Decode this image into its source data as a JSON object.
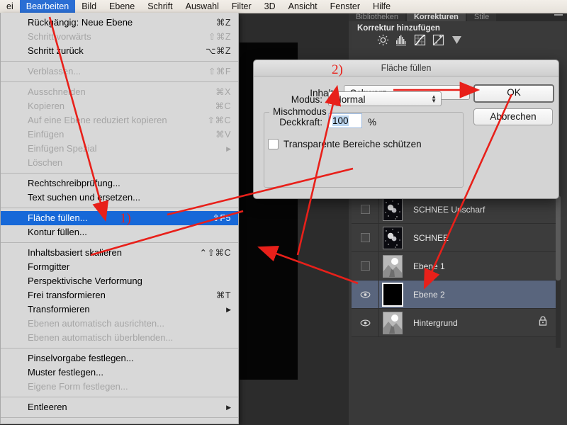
{
  "menubar": {
    "items": [
      {
        "label": "ei",
        "active": false,
        "truncated": true
      },
      {
        "label": "Bearbeiten",
        "active": true
      },
      {
        "label": "Bild",
        "active": false
      },
      {
        "label": "Ebene",
        "active": false
      },
      {
        "label": "Schrift",
        "active": false
      },
      {
        "label": "Auswahl",
        "active": false
      },
      {
        "label": "Filter",
        "active": false
      },
      {
        "label": "3D",
        "active": false
      },
      {
        "label": "Ansicht",
        "active": false
      },
      {
        "label": "Fenster",
        "active": false
      },
      {
        "label": "Hilfe",
        "active": false
      }
    ]
  },
  "edit_menu": {
    "rows": [
      {
        "type": "item",
        "label": "Rückgängig: Neue Ebene",
        "shortcut": "⌘Z",
        "disabled": false,
        "selected": false
      },
      {
        "type": "item",
        "label": "Schritt vorwärts",
        "shortcut": "⇧⌘Z",
        "disabled": true,
        "selected": false
      },
      {
        "type": "item",
        "label": "Schritt zurück",
        "shortcut": "⌥⌘Z",
        "disabled": false,
        "selected": false
      },
      {
        "type": "sep"
      },
      {
        "type": "item",
        "label": "Verblassen...",
        "shortcut": "⇧⌘F",
        "disabled": true,
        "selected": false
      },
      {
        "type": "sep"
      },
      {
        "type": "item",
        "label": "Ausschneiden",
        "shortcut": "⌘X",
        "disabled": true,
        "selected": false
      },
      {
        "type": "item",
        "label": "Kopieren",
        "shortcut": "⌘C",
        "disabled": true,
        "selected": false
      },
      {
        "type": "item",
        "label": "Auf eine Ebene reduziert kopieren",
        "shortcut": "⇧⌘C",
        "disabled": true,
        "selected": false
      },
      {
        "type": "item",
        "label": "Einfügen",
        "shortcut": "⌘V",
        "disabled": true,
        "selected": false
      },
      {
        "type": "item",
        "label": "Einfügen Spezial",
        "shortcut": "▶",
        "disabled": true,
        "selected": false,
        "submenu": true
      },
      {
        "type": "item",
        "label": "Löschen",
        "shortcut": "",
        "disabled": true,
        "selected": false
      },
      {
        "type": "sep"
      },
      {
        "type": "item",
        "label": "Rechtschreibprüfung...",
        "shortcut": "",
        "disabled": false,
        "selected": false
      },
      {
        "type": "item",
        "label": "Text suchen und ersetzen...",
        "shortcut": "",
        "disabled": false,
        "selected": false
      },
      {
        "type": "sep"
      },
      {
        "type": "item",
        "label": "Fläche füllen...",
        "shortcut": "⇧F5",
        "disabled": false,
        "selected": true
      },
      {
        "type": "item",
        "label": "Kontur füllen...",
        "shortcut": "",
        "disabled": false,
        "selected": false
      },
      {
        "type": "sep"
      },
      {
        "type": "item",
        "label": "Inhaltsbasiert skalieren",
        "shortcut": "⌃⇧⌘C",
        "disabled": false,
        "selected": false
      },
      {
        "type": "item",
        "label": "Formgitter",
        "shortcut": "",
        "disabled": false,
        "selected": false
      },
      {
        "type": "item",
        "label": "Perspektivische Verformung",
        "shortcut": "",
        "disabled": false,
        "selected": false
      },
      {
        "type": "item",
        "label": "Frei transformieren",
        "shortcut": "⌘T",
        "disabled": false,
        "selected": false
      },
      {
        "type": "item",
        "label": "Transformieren",
        "shortcut": "▶",
        "disabled": false,
        "selected": false,
        "submenu": true
      },
      {
        "type": "item",
        "label": "Ebenen automatisch ausrichten...",
        "shortcut": "",
        "disabled": true,
        "selected": false
      },
      {
        "type": "item",
        "label": "Ebenen automatisch überblenden...",
        "shortcut": "",
        "disabled": true,
        "selected": false
      },
      {
        "type": "sep"
      },
      {
        "type": "item",
        "label": "Pinselvorgabe festlegen...",
        "shortcut": "",
        "disabled": false,
        "selected": false
      },
      {
        "type": "item",
        "label": "Muster festlegen...",
        "shortcut": "",
        "disabled": false,
        "selected": false
      },
      {
        "type": "item",
        "label": "Eigene Form festlegen...",
        "shortcut": "",
        "disabled": true,
        "selected": false
      },
      {
        "type": "sep"
      },
      {
        "type": "item",
        "label": "Entleeren",
        "shortcut": "▶",
        "disabled": false,
        "selected": false,
        "submenu": true
      },
      {
        "type": "sep"
      }
    ]
  },
  "dock": {
    "tabs": [
      {
        "label": "Bibliotheken",
        "active": false
      },
      {
        "label": "Korrekturen",
        "active": true
      },
      {
        "label": "Stile",
        "active": false
      }
    ],
    "adjustments_title": "Korrektur hinzufügen",
    "adjustment_icons": [
      "brightness-contrast-icon",
      "levels-icon",
      "curves-icon",
      "exposure-icon",
      "vibrance-icon"
    ]
  },
  "layers": {
    "rows": [
      {
        "name": "SCHNEE Unscharf",
        "visible": false,
        "selected": false,
        "locked": false,
        "thumb": "snow-burst"
      },
      {
        "name": "SCHNEE",
        "visible": false,
        "selected": false,
        "locked": false,
        "thumb": "snow-burst"
      },
      {
        "name": "Ebene 1",
        "visible": false,
        "selected": false,
        "locked": false,
        "thumb": "photo"
      },
      {
        "name": "Ebene 2",
        "visible": true,
        "selected": true,
        "locked": false,
        "thumb": "black"
      },
      {
        "name": "Hintergrund",
        "visible": true,
        "selected": false,
        "locked": true,
        "thumb": "photo"
      }
    ]
  },
  "dialog": {
    "title": "Fläche füllen",
    "content_label": "Inhalt:",
    "content_value": "Schwarz",
    "ok_label": "OK",
    "cancel_label": "Abbrechen",
    "blend_group_label": "Mischmodus",
    "mode_label": "Modus:",
    "mode_value": "Normal",
    "opacity_label": "Deckkraft:",
    "opacity_value": "100",
    "percent_label": "%",
    "preserve_label": "Transparente Bereiche schützen",
    "preserve_checked": false
  },
  "annotations": {
    "step1": "1)",
    "step2": "2)",
    "arrow_color": "#e8201a"
  }
}
